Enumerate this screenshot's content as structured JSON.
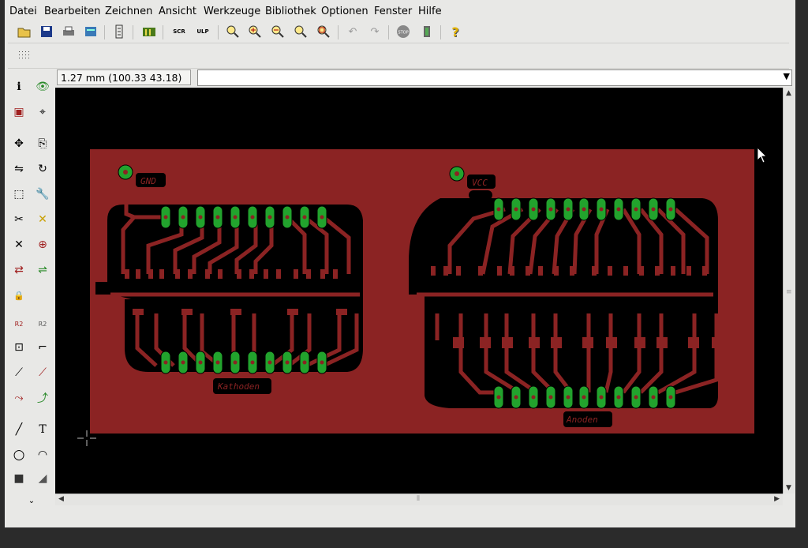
{
  "menu": [
    "Datei",
    "Bearbeiten",
    "Zeichnen",
    "Ansicht",
    "Werkzeuge",
    "Bibliothek",
    "Optionen",
    "Fenster",
    "Hilfe"
  ],
  "toolbar": {
    "icons": [
      "open-icon",
      "save-icon",
      "print-icon",
      "cam-icon",
      "board-switch-icon",
      "library-icon",
      "script-icon",
      "ulp-icon",
      "zoom-fit-icon",
      "zoom-in-icon",
      "zoom-out-icon",
      "zoom-redraw-icon",
      "zoom-select-icon",
      "undo-icon",
      "redo-icon",
      "stop-icon",
      "run-icon",
      "help-icon"
    ],
    "script_label": "SCR",
    "ulp_label": "ULP",
    "stop_label": "STOP",
    "help_label": "?"
  },
  "coordinates": "1.27 mm (100.33 43.18)",
  "command_line": {
    "value": ""
  },
  "left_tools": [
    {
      "name": "info-tool",
      "label": "i"
    },
    {
      "name": "show-tool",
      "label": "👁"
    },
    {
      "name": "layers-tool",
      "label": "▣"
    },
    {
      "name": "mark-tool",
      "label": "⌖"
    },
    {
      "name": "move-tool",
      "label": "✥"
    },
    {
      "name": "copy-tool",
      "label": "⎘"
    },
    {
      "name": "mirror-tool",
      "label": "⇋"
    },
    {
      "name": "rotate-tool",
      "label": "↻"
    },
    {
      "name": "group-tool",
      "label": "⬚"
    },
    {
      "name": "change-tool",
      "label": "🔧"
    },
    {
      "name": "paste-tool",
      "label": "✂"
    },
    {
      "name": "delete-tool",
      "label": "✕"
    },
    {
      "name": "add-tool",
      "label": "⊕"
    },
    {
      "name": "pinswap-tool",
      "label": "⇄"
    },
    {
      "name": "replace-tool",
      "label": "⇌"
    },
    {
      "name": "lock-tool",
      "label": "🔒"
    },
    {
      "name": "name-tool",
      "label": "R2"
    },
    {
      "name": "value-tool",
      "label": "R2"
    },
    {
      "name": "smash-tool",
      "label": "⊡"
    },
    {
      "name": "miter-tool",
      "label": "⌐"
    },
    {
      "name": "split-tool",
      "label": "⟋"
    },
    {
      "name": "optimize-tool",
      "label": "⟋"
    },
    {
      "name": "route-tool",
      "label": "⤳"
    },
    {
      "name": "ripup-tool",
      "label": "⤴"
    },
    {
      "name": "wire-tool",
      "label": "╱"
    },
    {
      "name": "text-tool",
      "label": "T"
    },
    {
      "name": "circle-tool",
      "label": "○"
    },
    {
      "name": "arc-tool",
      "label": "◠"
    },
    {
      "name": "rect-tool",
      "label": "■"
    },
    {
      "name": "polygon-tool",
      "label": "◢"
    }
  ],
  "labels": {
    "gnd": "GND",
    "vcc": "VCC",
    "kathoden": "Kathoden",
    "anoden": "Anoden"
  },
  "colors": {
    "board": "#8b2323",
    "pad": "#22a32d",
    "background": "#000000",
    "copper_outline": "#000000"
  }
}
